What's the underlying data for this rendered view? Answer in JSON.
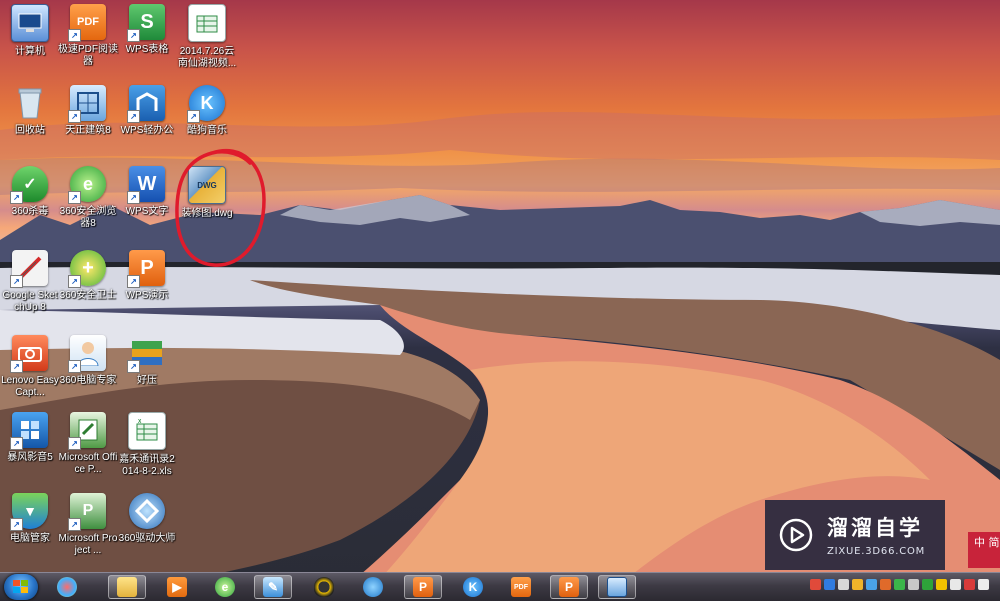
{
  "desktop": {
    "icons": [
      {
        "label": "计算机"
      },
      {
        "label": "极速PDF阅读器"
      },
      {
        "label": "WPS表格"
      },
      {
        "label": "2014.7.26云南仙湖视频..."
      },
      {
        "label": "回收站"
      },
      {
        "label": "天正建筑8"
      },
      {
        "label": "WPS轻办公"
      },
      {
        "label": "酷狗音乐"
      },
      {
        "label": "360杀毒"
      },
      {
        "label": "360安全浏览器8"
      },
      {
        "label": "WPS文字"
      },
      {
        "label": "装修图.dwg"
      },
      {
        "label": "Google SketchUp 8"
      },
      {
        "label": "360安全卫士"
      },
      {
        "label": "WPS演示"
      },
      {
        "label": "Lenovo EasyCapt..."
      },
      {
        "label": "360电脑专家"
      },
      {
        "label": "好压"
      },
      {
        "label": "暴风影音5"
      },
      {
        "label": "Microsoft Office P..."
      },
      {
        "label": "嘉禾通讯录2014-8-2.xls"
      },
      {
        "label": "电脑管家"
      },
      {
        "label": "Microsoft Project ..."
      },
      {
        "label": "360驱动大师"
      }
    ]
  },
  "icon_glyphs": {
    "pdf": "PDF",
    "wps_sheet": "S",
    "wps_word": "W",
    "wps_show": "P",
    "kugou": "K",
    "dwg": "DWG"
  },
  "highlight": {
    "color": "#e01b2c"
  },
  "watermark": {
    "name": "溜溜自学",
    "url": "ZIXUE.3D66.COM",
    "badge": "中 简"
  },
  "taskbar": {
    "items": [
      {
        "name": "explorer",
        "glyph": ""
      },
      {
        "name": "media-player",
        "glyph": ""
      },
      {
        "name": "360-browser",
        "glyph": ""
      },
      {
        "name": "feather-app",
        "glyph": ""
      },
      {
        "name": "qq",
        "glyph": ""
      },
      {
        "name": "qq-browser",
        "glyph": ""
      },
      {
        "name": "wps-presentation",
        "glyph": "P"
      },
      {
        "name": "kugou",
        "glyph": "K"
      },
      {
        "name": "pdf-reader",
        "glyph": "PDF"
      },
      {
        "name": "wps-presentation-2",
        "glyph": "P"
      },
      {
        "name": "tianzheng",
        "glyph": ""
      }
    ]
  },
  "colors": {
    "accent_orange": "#f07b1f",
    "wps_blue": "#1769c8",
    "wps_green": "#2e9a4e",
    "taskbar": "#3d3a44"
  }
}
